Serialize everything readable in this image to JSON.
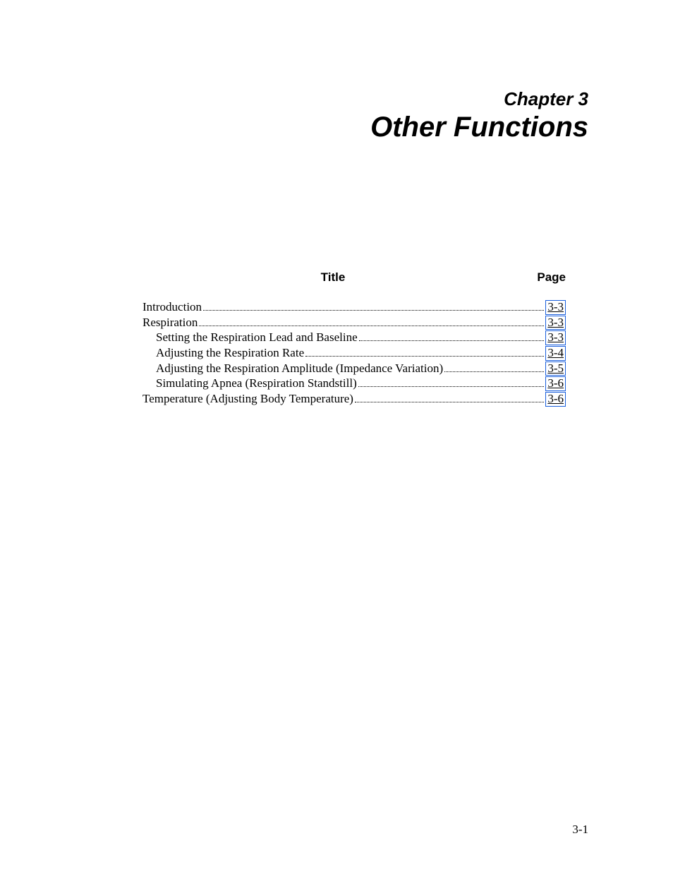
{
  "chapter": {
    "label": "Chapter 3",
    "title": "Other Functions"
  },
  "toc": {
    "header_title": "Title",
    "header_page": "Page",
    "entries": [
      {
        "title": "Introduction",
        "page": "3-3",
        "indent": 0
      },
      {
        "title": "Respiration",
        "page": "3-3",
        "indent": 0
      },
      {
        "title": "Setting the Respiration Lead and Baseline",
        "page": "3-3",
        "indent": 1
      },
      {
        "title": "Adjusting the Respiration Rate",
        "page": "3-4",
        "indent": 1
      },
      {
        "title": "Adjusting the Respiration Amplitude (Impedance Variation)",
        "page": "3-5",
        "indent": 1
      },
      {
        "title": "Simulating Apnea (Respiration Standstill)",
        "page": "3-6",
        "indent": 1
      },
      {
        "title": "Temperature (Adjusting Body Temperature)",
        "page": "3-6",
        "indent": 0
      }
    ]
  },
  "page_number": "3-1"
}
